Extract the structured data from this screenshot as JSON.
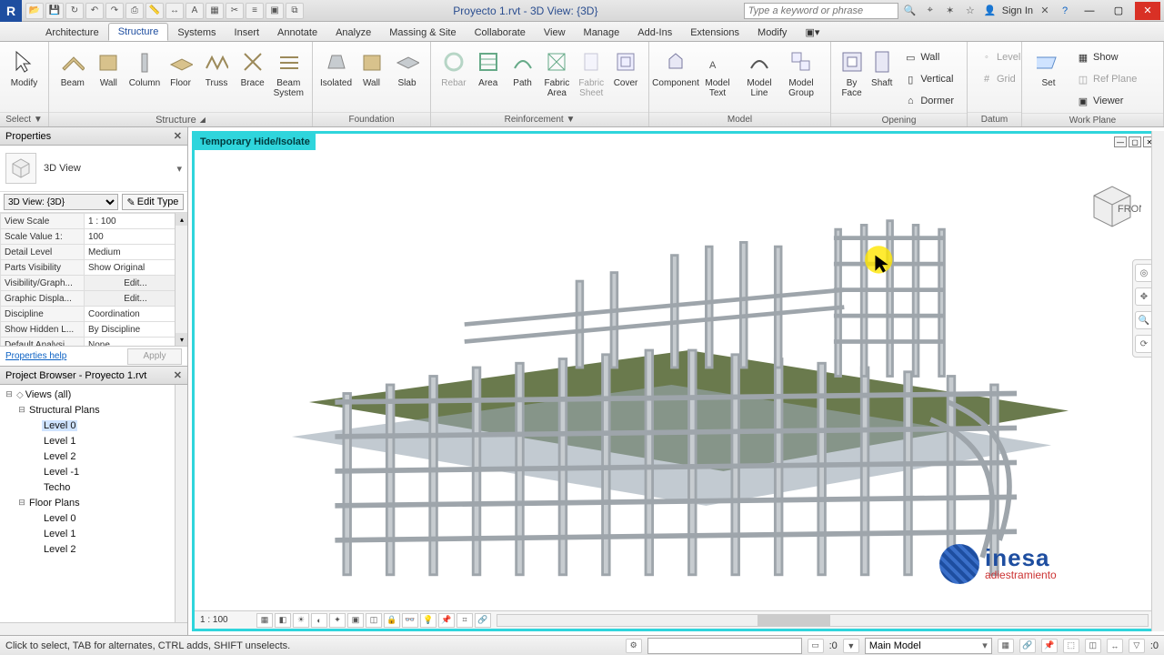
{
  "title": "Proyecto 1.rvt - 3D View: {3D}",
  "search_placeholder": "Type a keyword or phrase",
  "signin": "Sign In",
  "tabs": [
    "Architecture",
    "Structure",
    "Systems",
    "Insert",
    "Annotate",
    "Analyze",
    "Massing & Site",
    "Collaborate",
    "View",
    "Manage",
    "Add-Ins",
    "Extensions",
    "Modify"
  ],
  "active_tab": "Structure",
  "panel_modify": {
    "title": "Select ▼",
    "modify": "Modify"
  },
  "panel_structure": {
    "title": "Structure",
    "btns": [
      "Beam",
      "Wall",
      "Column",
      "Floor",
      "Truss",
      "Brace",
      "Beam\nSystem"
    ]
  },
  "panel_foundation": {
    "title": "Foundation",
    "btns": [
      "Isolated",
      "Wall",
      "Slab"
    ]
  },
  "panel_reinf": {
    "title": "Reinforcement ▼",
    "btns": [
      "Rebar",
      "Area",
      "Path",
      "Fabric\nArea",
      "Fabric\nSheet",
      "Cover"
    ]
  },
  "panel_model": {
    "title": "Model",
    "btns": [
      "Component",
      "Model\nText",
      "Model\nLine",
      "Model\nGroup"
    ]
  },
  "panel_opening": {
    "title": "Opening",
    "btns": [
      "By\nFace",
      "Shaft"
    ],
    "small": [
      "Wall",
      "Vertical",
      "Dormer"
    ]
  },
  "panel_datum": {
    "title": "Datum",
    "small": [
      "Level",
      "Grid"
    ]
  },
  "panel_wp": {
    "title": "Work Plane",
    "btns": [
      "Set"
    ],
    "small": [
      "Show",
      "Ref Plane",
      "Viewer"
    ]
  },
  "properties": {
    "title": "Properties",
    "type_name": "3D View",
    "instance": "3D View: {3D}",
    "edit_type": "Edit Type",
    "rows": [
      [
        "View Scale",
        "1 : 100"
      ],
      [
        "Scale Value   1:",
        "100"
      ],
      [
        "Detail Level",
        "Medium"
      ],
      [
        "Parts Visibility",
        "Show Original"
      ],
      [
        "Visibility/Graph...",
        "Edit..."
      ],
      [
        "Graphic Displa...",
        "Edit..."
      ],
      [
        "Discipline",
        "Coordination"
      ],
      [
        "Show Hidden L...",
        "By Discipline"
      ],
      [
        "Default Analysi...",
        "None"
      ]
    ],
    "help": "Properties help",
    "apply": "Apply"
  },
  "browser": {
    "title": "Project Browser - Proyecto 1.rvt",
    "root": "Views (all)",
    "groups": [
      {
        "name": "Structural Plans",
        "items": [
          "Level 0",
          "Level 1",
          "Level 2",
          "Level -1",
          "Techo"
        ],
        "selected": "Level 0"
      },
      {
        "name": "Floor Plans",
        "items": [
          "Level 0",
          "Level 1",
          "Level 2"
        ]
      }
    ]
  },
  "view": {
    "banner": "Temporary Hide/Isolate",
    "scale": "1 : 100"
  },
  "status": {
    "hint": "Click to select, TAB for alternates, CTRL adds, SHIFT unselects.",
    "zero": ":0",
    "workset": "Main Model"
  },
  "watermark": {
    "line1": "inesa",
    "line2": "adiestramiento"
  }
}
